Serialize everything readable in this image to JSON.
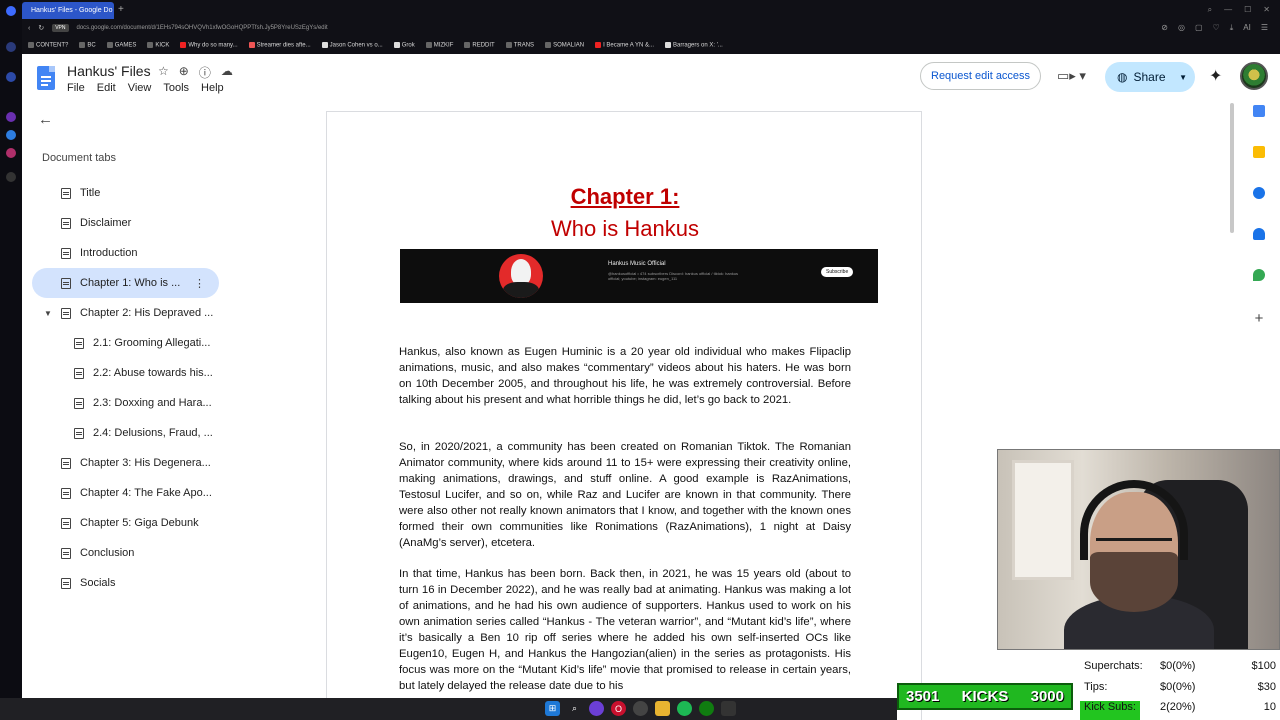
{
  "browser": {
    "tab_title": "Hankus' Files - Google Do",
    "new_tab": "+",
    "vpn_badge": "VPN",
    "url": "docs.google.com/document/d/1EHs794sOHVQVh1xfwOGoHQPPTfsh.Jy5P8YreUSzEgYs/edit",
    "bookmarks": [
      "CONTENT?",
      "BC",
      "GAMES",
      "KICK",
      "Why do so many...",
      "Streamer dies afte...",
      "Jason Cohen vs o...",
      "Grok",
      "MIZKIF",
      "REDDIT",
      "TRANS",
      "SOMALIAN",
      "I Became A YN &...",
      "Barragers on X: '..."
    ]
  },
  "docs": {
    "title": "Hankus' Files",
    "menu": [
      "File",
      "Edit",
      "View",
      "Tools",
      "Help"
    ],
    "request_edit_label": "Request edit access",
    "share_label": "Share"
  },
  "sidebar": {
    "heading": "Document tabs",
    "items": [
      {
        "label": "Title"
      },
      {
        "label": "Disclaimer"
      },
      {
        "label": "Introduction"
      },
      {
        "label": "Chapter 1: Who is ..."
      },
      {
        "label": "Chapter 2: His Depraved ..."
      },
      {
        "label": "2.1: Grooming Allegati..."
      },
      {
        "label": "2.2: Abuse towards his..."
      },
      {
        "label": "2.3: Doxxing and Hara..."
      },
      {
        "label": "2.4: Delusions, Fraud, ..."
      },
      {
        "label": "Chapter 3: His Degenera..."
      },
      {
        "label": "Chapter 4: The Fake Apo..."
      },
      {
        "label": "Chapter 5: Giga Debunk"
      },
      {
        "label": "Conclusion"
      },
      {
        "label": "Socials"
      }
    ]
  },
  "document": {
    "chapter_title": "Chapter 1:",
    "chapter_subtitle": "Who is Hankus",
    "banner": {
      "channel_name": "Hankus Music Official",
      "channel_meta": "@hankusofficial • 474 subscribers\nDiscord: hankus official / tiktok: hankus official; youtube; instagram: eugen_111",
      "subscribe_label": "Subscribe"
    },
    "paragraphs": [
      "Hankus, also known as Eugen Huminic is a 20 year old individual who makes Flipaclip animations, music, and also makes “commentary” videos about his haters. He was born on 10th December 2005, and throughout his life, he was extremely controversial. Before talking about his present and what horrible things he did, let’s go back to 2021.",
      "So, in 2020/2021, a community has been created on Romanian Tiktok. The Romanian Animator community, where kids around 11 to 15+ were expressing their creativity online, making animations, drawings, and stuff online. A good example is RazAnimations, Testosul Lucifer, and so on, while Raz and Lucifer are known in that community. There were also other not really known animators that I know, and together with the known ones formed their own communities like Ronimations (RazAnimations), 1 night at Daisy (AnaMg’s server), etcetera.",
      "In that time, Hankus has been born. Back then, in 2021, he was 15 years old (about to turn 16 in December 2022), and he was really bad at animating. Hankus was making a lot of animations, and he had his own audience of supporters. Hankus used to work on his own animation series called “Hankus - The veteran warrior”, and “Mutant kid’s life”, where it’s basically a Ben 10 rip off series where he added his own self-inserted OCs like Eugen10, Eugen H, and Hankus the Hangozian(alien) in the series as protagonists. His focus was more on the “Mutant Kid’s life” movie that promised to release in certain years, but lately delayed the release date due to his"
    ]
  },
  "overlay": {
    "kicks_current": "3501",
    "kicks_label": "KICKS",
    "kicks_goal": "3000",
    "stats": [
      {
        "label": "Superchats:",
        "value": "$0(0%)",
        "target": "$100"
      },
      {
        "label": "Tips:",
        "value": "$0(0%)",
        "target": "$30"
      },
      {
        "label": "Kick Subs:",
        "value": "2(20%)",
        "target": "10",
        "progress": 0.2
      }
    ]
  },
  "colors": {
    "chapter_red": "#c00000",
    "share_bg": "#c2e7ff",
    "active_tab_bg": "#d3e3fd",
    "kick_green": "#22c51f"
  }
}
